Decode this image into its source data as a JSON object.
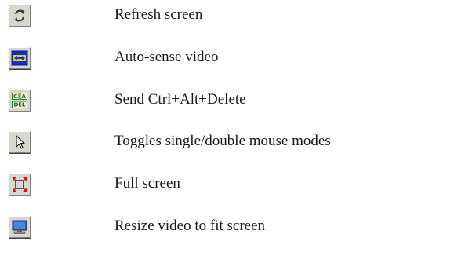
{
  "toolbar_legend": {
    "items": [
      {
        "icon": "refresh-icon",
        "label": "Refresh screen"
      },
      {
        "icon": "auto-sense-video-icon",
        "label": "Auto-sense video"
      },
      {
        "icon": "ctrl-alt-del-icon",
        "label": "Send Ctrl+Alt+Delete"
      },
      {
        "icon": "mouse-pointer-icon",
        "label": "Toggles single/double mouse modes"
      },
      {
        "icon": "full-screen-icon",
        "label": "Full screen"
      },
      {
        "icon": "resize-video-icon",
        "label": "Resize video to fit screen"
      }
    ],
    "icon_text": {
      "ctrl_alt_del": [
        "C",
        "A",
        "DEL"
      ]
    },
    "colors": {
      "button_face": "#d9d6ce",
      "auto_sense_blue": "#1030c8",
      "auto_sense_yellow": "#f0d000",
      "ctrl_alt_del_green": "#2c7a2c",
      "full_screen_red": "#d01818",
      "monitor_blue": "#2a66c0"
    }
  }
}
